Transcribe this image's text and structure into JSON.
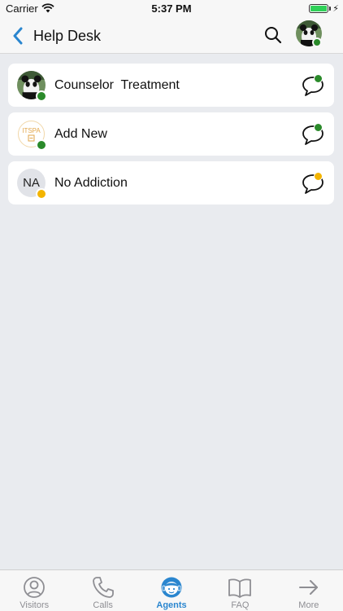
{
  "status_bar": {
    "carrier": "Carrier",
    "time": "5:37 PM"
  },
  "nav": {
    "title": "Help Desk",
    "back_icon": "chevron-left-icon",
    "search_icon": "search-icon"
  },
  "agents": [
    {
      "name": "Counselor  Treatment",
      "initials": "",
      "avatar": "photo",
      "status": "online",
      "status_color": "#2a8a2a"
    },
    {
      "name": "Add New",
      "initials": "",
      "avatar": "itspa-logo",
      "status": "online",
      "status_color": "#2a8a2a"
    },
    {
      "name": "No Addiction",
      "initials": "NA",
      "avatar": "initials",
      "status": "away",
      "status_color": "#f3b400"
    }
  ],
  "itspa_logo_text": "ITSPA",
  "tabs": [
    {
      "label": "Visitors",
      "icon": "person-circle-icon",
      "active": false
    },
    {
      "label": "Calls",
      "icon": "phone-icon",
      "active": false
    },
    {
      "label": "Agents",
      "icon": "agent-headset-icon",
      "active": true
    },
    {
      "label": "FAQ",
      "icon": "book-icon",
      "active": false
    },
    {
      "label": "More",
      "icon": "arrow-right-icon",
      "active": false
    }
  ],
  "colors": {
    "accent": "#2a86cf",
    "online": "#2a8a2a",
    "away": "#f3b400",
    "background": "#e9ebef"
  }
}
